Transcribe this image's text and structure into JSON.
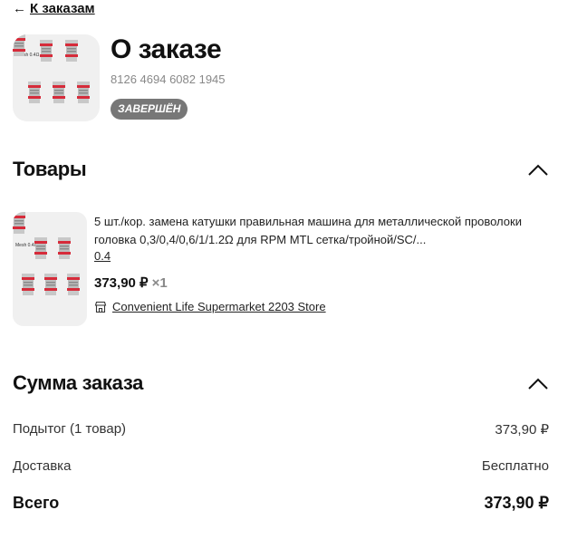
{
  "nav": {
    "back_arrow": "←",
    "back_label": "К заказам"
  },
  "order": {
    "title": "О заказе",
    "number": "8126 4694 6082 1945",
    "status": "ЗАВЕРШЁН",
    "image_label": "Mesh 0.4Ω"
  },
  "products_section": {
    "title": "Товары",
    "items": [
      {
        "name": "5 шт./кор. замена катушки правильная машина для металлической проволоки головка 0,3/0,4/0,6/1/1.2Ω для RPM MTL сетка/тройной/SC/...",
        "variant": "0.4",
        "price": "373,90 ₽",
        "qty": "×1",
        "store": "Convenient Life Supermarket 2203 Store",
        "image_label": "Mesh 0.4Ω",
        "store_icon": "shop-icon"
      }
    ]
  },
  "summary": {
    "title": "Сумма заказа",
    "subtotal_label": "Подытог (1 товар)",
    "subtotal_value": "373,90 ₽",
    "delivery_label": "Доставка",
    "delivery_value": "Бесплатно",
    "total_label": "Всего",
    "total_value": "373,90 ₽"
  },
  "colors": {
    "badge_bg": "#777777",
    "coil_red": "#d62b3a",
    "muted": "#888888"
  }
}
